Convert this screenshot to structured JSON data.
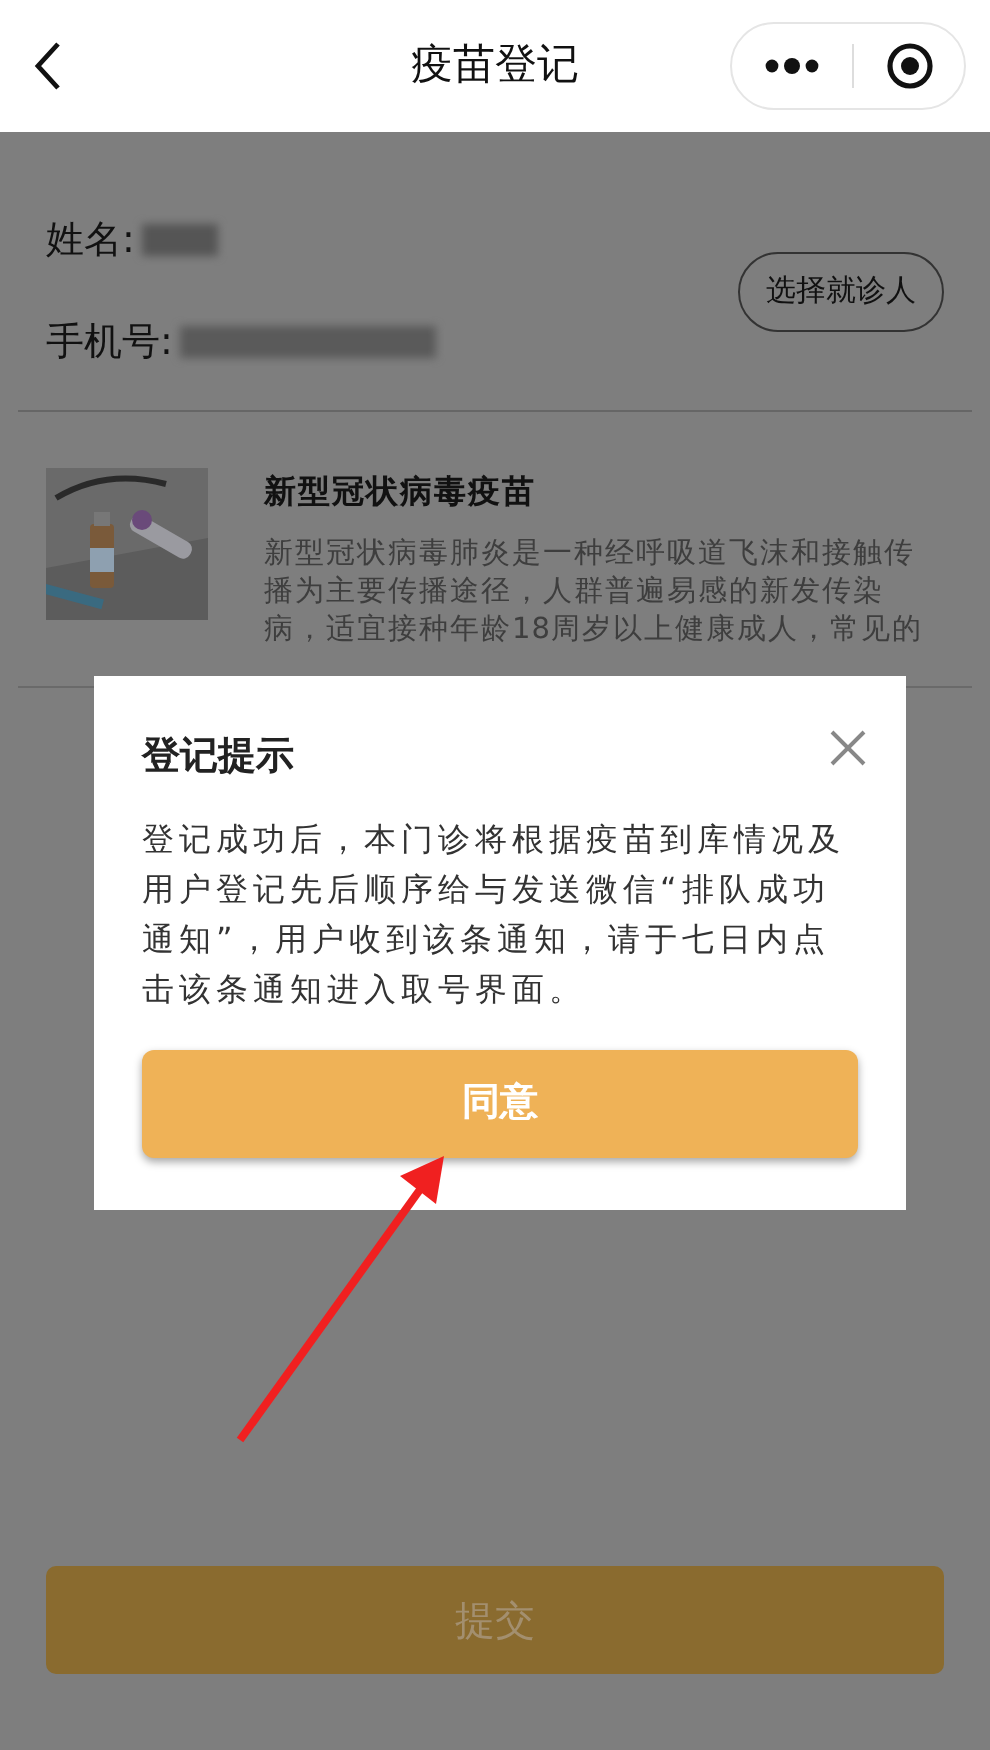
{
  "header": {
    "title": "疫苗登记"
  },
  "patient": {
    "name_label": "姓名:",
    "phone_label": "手机号:",
    "select_button": "选择就诊人"
  },
  "vaccine": {
    "title": "新型冠状病毒疫苗",
    "description": "新型冠状病毒肺炎是一种经呼吸道飞沫和接触传播为主要传播途径，人群普遍易感的新发传染病，适宜接种年龄18周岁以上健康成人，常见的"
  },
  "submit_button": "提交",
  "dialog": {
    "title": "登记提示",
    "message": "登记成功后，本门诊将根据疫苗到库情况及用户登记先后顺序给与发送微信“排队成功通知”，用户收到该条通知，请于七日内点击该条通知进入取号界面。",
    "confirm_button": "同意"
  }
}
